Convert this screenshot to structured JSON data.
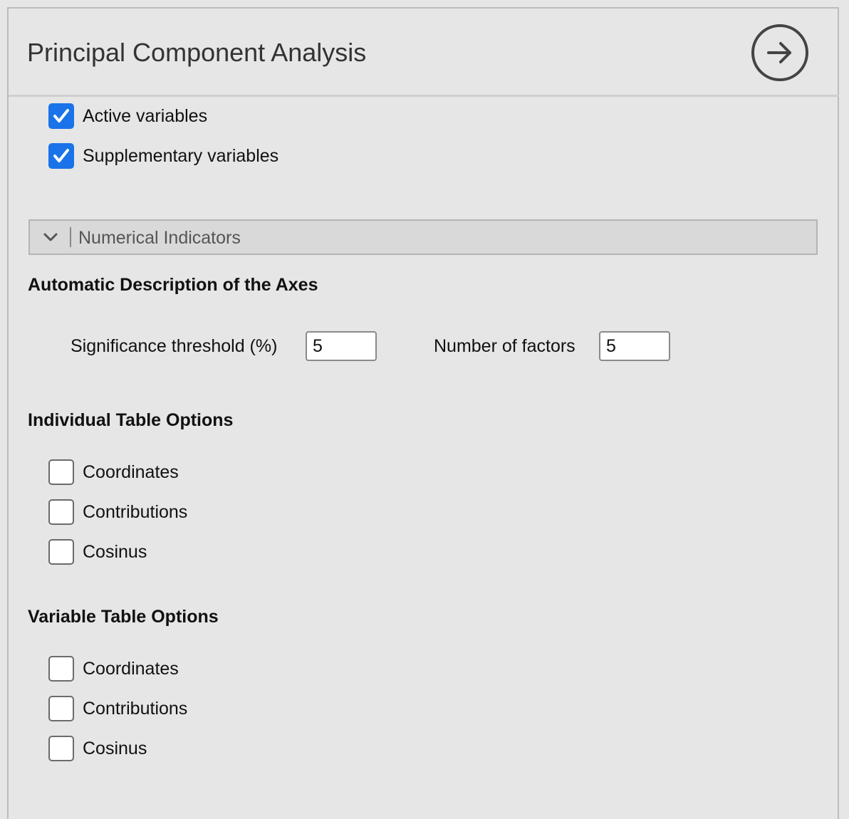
{
  "header": {
    "title": "Principal Component Analysis",
    "go_icon": "arrow-right-circle-icon"
  },
  "variables": [
    {
      "label": "Active variables",
      "checked": true
    },
    {
      "label": "Supplementary variables",
      "checked": true
    }
  ],
  "section": {
    "label": "Numerical Indicators",
    "icon": "chevron-down-icon",
    "expanded": true
  },
  "axes": {
    "heading": "Automatic Description of the Axes",
    "threshold_label": "Significance threshold (%)",
    "threshold_value": "5",
    "factors_label": "Number of factors",
    "factors_value": "5"
  },
  "individual_table": {
    "heading": "Individual Table Options",
    "options": [
      {
        "label": "Coordinates",
        "checked": false
      },
      {
        "label": "Contributions",
        "checked": false
      },
      {
        "label": "Cosinus",
        "checked": false
      }
    ]
  },
  "variable_table": {
    "heading": "Variable Table Options",
    "options": [
      {
        "label": "Coordinates",
        "checked": false
      },
      {
        "label": "Contributions",
        "checked": false
      },
      {
        "label": "Cosinus",
        "checked": false
      }
    ]
  },
  "colors": {
    "accent": "#1a73e8",
    "background": "#e6e6e6",
    "section_bar": "#d9d9d9"
  }
}
